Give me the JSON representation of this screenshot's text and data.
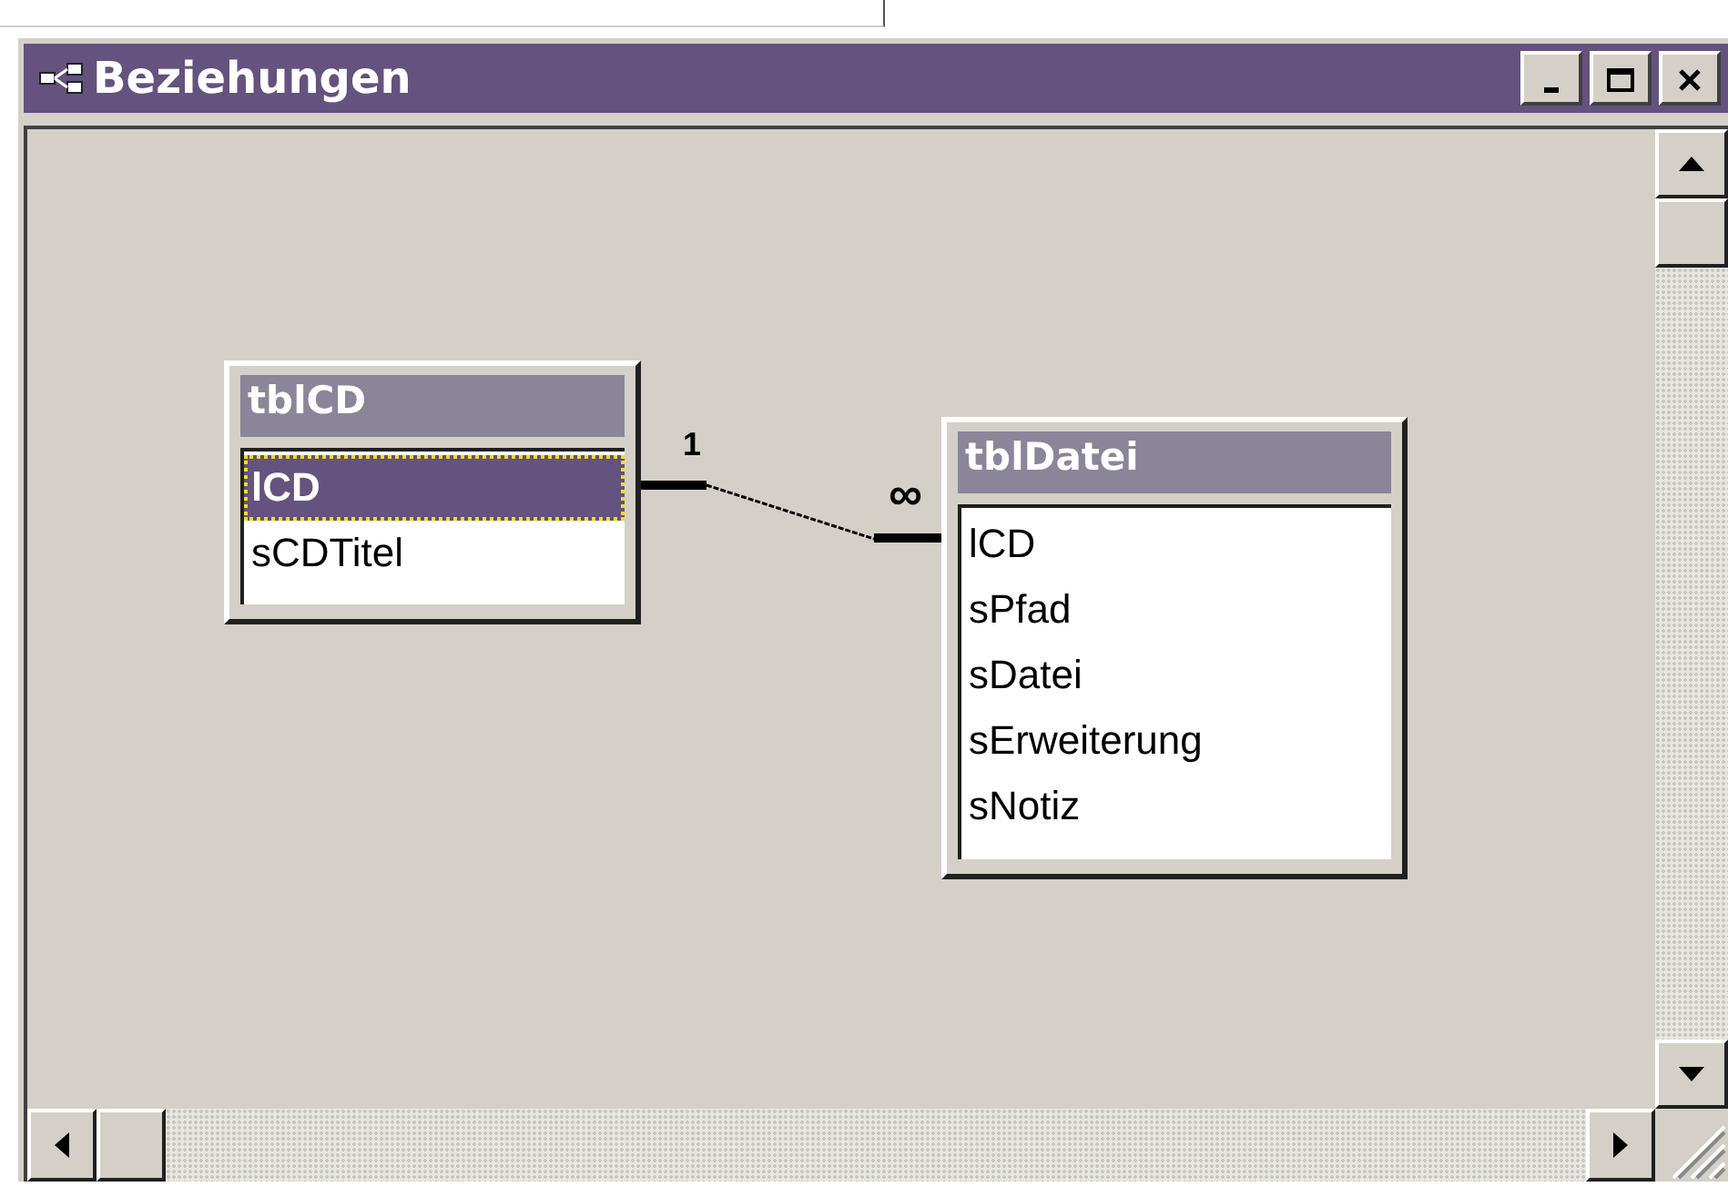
{
  "window": {
    "title": "Beziehungen"
  },
  "tables": [
    {
      "name": "tblCD",
      "fields": [
        {
          "label": "lCD",
          "selected": true
        },
        {
          "label": "sCDTitel",
          "selected": false
        }
      ]
    },
    {
      "name": "tblDatei",
      "fields": [
        {
          "label": "lCD",
          "selected": false
        },
        {
          "label": "sPfad",
          "selected": false
        },
        {
          "label": "sDatei",
          "selected": false
        },
        {
          "label": "sErweiterung",
          "selected": false
        },
        {
          "label": "sNotiz",
          "selected": false
        }
      ]
    }
  ],
  "relationships": [
    {
      "from_label": "1",
      "to_label": "∞"
    }
  ]
}
